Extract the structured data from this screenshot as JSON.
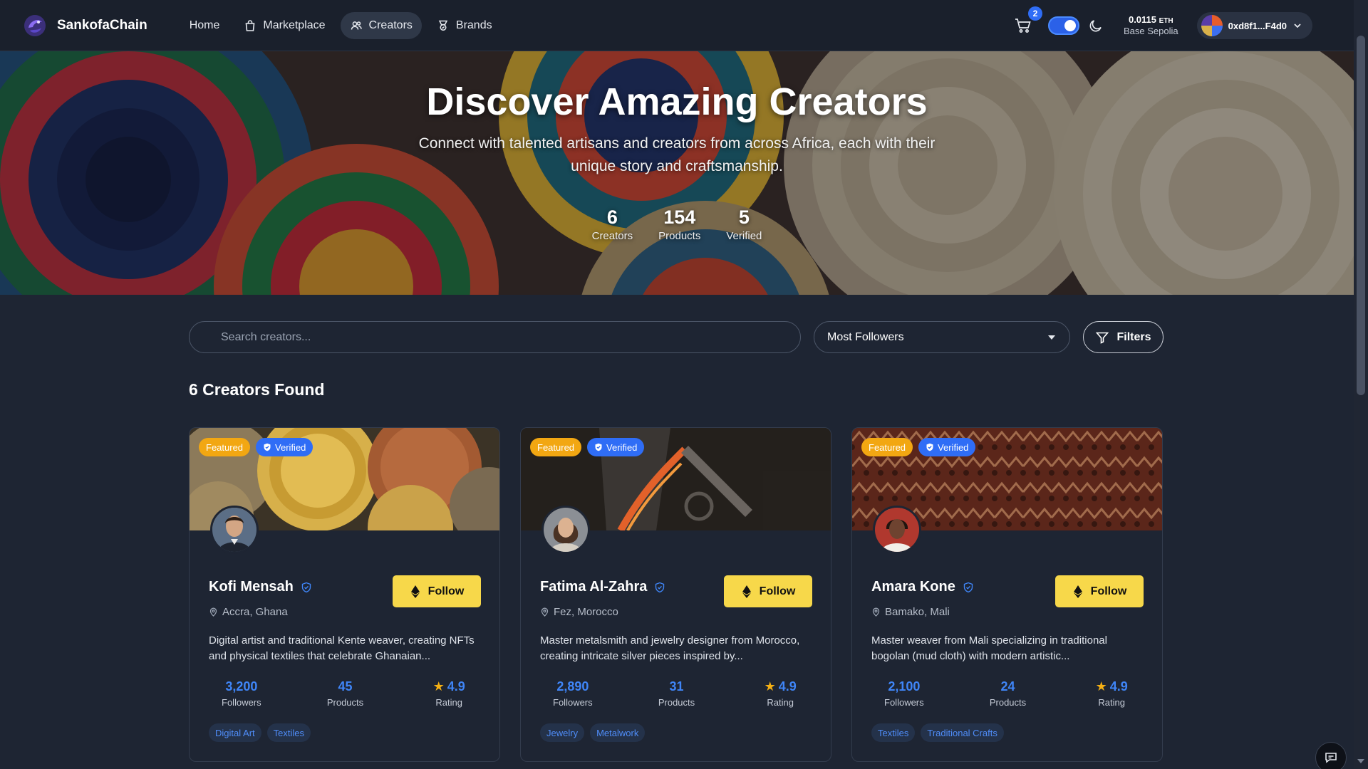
{
  "brand": {
    "name": "SankofaChain"
  },
  "nav": {
    "links": [
      {
        "label": "Home",
        "icon": "none"
      },
      {
        "label": "Marketplace",
        "icon": "shopping-bag-icon"
      },
      {
        "label": "Creators",
        "icon": "users-icon",
        "active": true
      },
      {
        "label": "Brands",
        "icon": "award-icon"
      }
    ],
    "cart_count": "2",
    "balance": {
      "amount": "0.0115",
      "unit": "ETH",
      "network": "Base Sepolia"
    },
    "wallet_address": "0xd8f1...F4d0"
  },
  "hero": {
    "title": "Discover Amazing Creators",
    "subtitle": "Connect with talented artisans and creators from across Africa, each with their unique story and craftsmanship.",
    "stats": [
      {
        "value": "6",
        "label": "Creators"
      },
      {
        "value": "154",
        "label": "Products"
      },
      {
        "value": "5",
        "label": "Verified"
      }
    ]
  },
  "search": {
    "placeholder": "Search creators..."
  },
  "sort": {
    "selected": "Most Followers"
  },
  "filters_label": "Filters",
  "results_heading": "6 Creators Found",
  "colors": {
    "accent": "#2f6df6",
    "follow": "#f7d84a",
    "featured": "#f2a712",
    "stat": "#3f85f7"
  },
  "creators": [
    {
      "featured_label": "Featured",
      "verified_label": "Verified",
      "name": "Kofi Mensah",
      "location": "Accra, Ghana",
      "description": "Digital artist and traditional Kente weaver, creating NFTs and physical textiles that celebrate Ghanaian...",
      "follow_label": "Follow",
      "followers": "3,200",
      "followers_label": "Followers",
      "products": "45",
      "products_label": "Products",
      "rating": "4.9",
      "rating_label": "Rating",
      "tags": [
        "Digital Art",
        "Textiles"
      ]
    },
    {
      "featured_label": "Featured",
      "verified_label": "Verified",
      "name": "Fatima Al-Zahra",
      "location": "Fez, Morocco",
      "description": "Master metalsmith and jewelry designer from Morocco, creating intricate silver pieces inspired by...",
      "follow_label": "Follow",
      "followers": "2,890",
      "followers_label": "Followers",
      "products": "31",
      "products_label": "Products",
      "rating": "4.9",
      "rating_label": "Rating",
      "tags": [
        "Jewelry",
        "Metalwork"
      ]
    },
    {
      "featured_label": "Featured",
      "verified_label": "Verified",
      "name": "Amara Kone",
      "location": "Bamako, Mali",
      "description": "Master weaver from Mali specializing in traditional bogolan (mud cloth) with modern artistic...",
      "follow_label": "Follow",
      "followers": "2,100",
      "followers_label": "Followers",
      "products": "24",
      "products_label": "Products",
      "rating": "4.9",
      "rating_label": "Rating",
      "tags": [
        "Textiles",
        "Traditional Crafts"
      ]
    }
  ]
}
